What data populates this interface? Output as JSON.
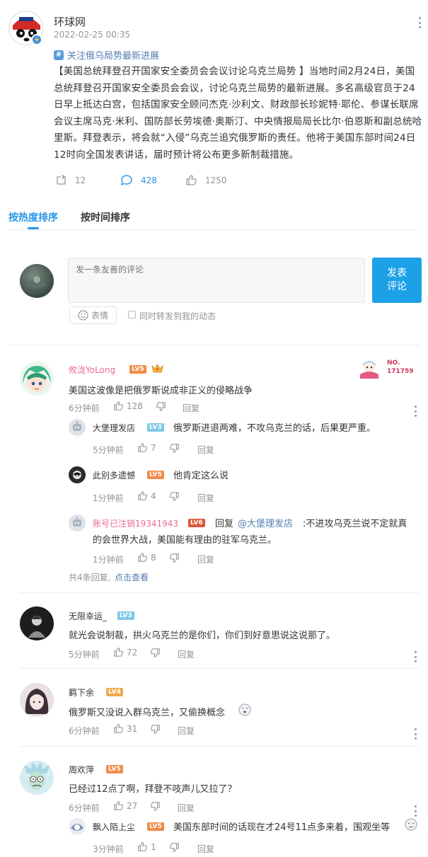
{
  "post": {
    "author": "环球网",
    "timestamp": "2022-02-25 00:35",
    "topic": "关注俄乌局势最新进展",
    "body": "【美国总统拜登召开国家安全委员会会议讨论乌克兰局势 】当地时间2月24日，美国总统拜登召开国家安全委员会会议，讨论乌克兰局势的最新进展。多名高级官员于24日早上抵达白宫，包括国家安全顾问杰克·沙利文、财政部长珍妮特·耶伦、参谋长联席会议主席马克·米利、国防部长劳埃德·奥斯汀、中央情报局局长比尔·伯恩斯和副总统哈里斯。拜登表示，将会就“入侵”乌克兰追究俄罗斯的责任。他将于美国东部时间24日12时向全国发表讲话，届时预计将公布更多新制裁措施。",
    "reposts": "12",
    "comments": "428",
    "likes": "1250"
  },
  "tabs": {
    "hot": "按热度排序",
    "time": "按时间排序"
  },
  "composer": {
    "placeholder": "发一条友善的评论",
    "submit_line1": "发表",
    "submit_line2": "评论",
    "emoji_label": "表情",
    "repost_label": "同时转发到我的动态"
  },
  "comments": [
    {
      "user": "攸泷YoLong",
      "level": "LV5",
      "text": "美国这波像是把俄罗斯说成非正义的侵略战争",
      "time": "6分钟前",
      "likes": "128",
      "reply": "回复",
      "badge_no": "NO.",
      "badge_num": "171759",
      "replies": [
        {
          "user": "大堡理发店",
          "level": "LV3",
          "text": "俄罗斯进退两难，不攻乌克兰的话，后果更严重。",
          "time": "5分钟前",
          "likes": "7",
          "reply": "回复"
        },
        {
          "user": "此别多遗憾",
          "level": "LV5",
          "text": "他肯定这么说",
          "time": "1分钟前",
          "likes": "4",
          "reply": "回复"
        },
        {
          "user": "账号已注销19341943",
          "level": "LV6",
          "reply_prefix": "回复",
          "mention": "@大堡理发店",
          "text1": ":不进攻乌克兰说不定就真",
          "text2": "的会世界大战，美国能有理由的驻军乌克兰。",
          "time": "1分钟前",
          "likes": "8",
          "reply": "回复"
        }
      ],
      "more_prefix": "共4条回复,",
      "more_link": "点击查看"
    },
    {
      "user": "无限幸运_",
      "level": "LV3",
      "text": "就光会说制裁，拱火乌克兰的是你们，你们到好意思说这说那了。",
      "time": "5分钟前",
      "likes": "72",
      "reply": "回复"
    },
    {
      "user": "羁下余",
      "level": "LV4",
      "text": "俄罗斯又没说入群乌克兰，又偷换概念",
      "time": "6分钟前",
      "likes": "31",
      "reply": "回复"
    },
    {
      "user": "周欢萍",
      "level": "LV5",
      "text": "已经过12点了啊，拜登不吱声儿又拉了？",
      "time": "6分钟前",
      "likes": "27",
      "reply": "回复",
      "replies": [
        {
          "user": "飘入陌上尘",
          "level": "LV5",
          "text": "美国东部时间的话现在才24号11点多来着，围观坐等",
          "time": "3分钟前",
          "likes": "1",
          "reply": "回复"
        }
      ]
    }
  ],
  "colors": {
    "accent": "#eb7350",
    "link": "#507daf",
    "button": "#1da1e6",
    "vip_name": "#e86b95"
  }
}
